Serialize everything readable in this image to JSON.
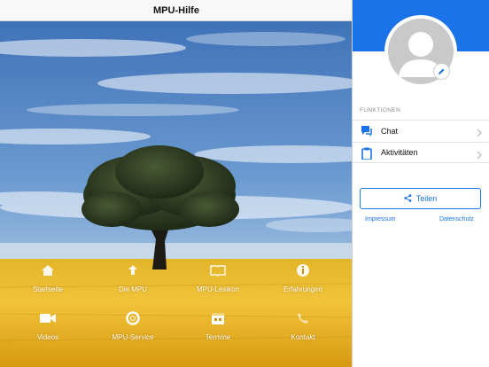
{
  "navbar": {
    "title": "MPU-Hilfe"
  },
  "grid": {
    "tiles": [
      {
        "label": "Startseite",
        "icon": "home-icon"
      },
      {
        "label": "Die MPU",
        "icon": "upload-icon"
      },
      {
        "label": "MPU-Lexikon",
        "icon": "book-icon"
      },
      {
        "label": "Erfahrungen",
        "icon": "info-icon"
      },
      {
        "label": "Videos",
        "icon": "video-icon"
      },
      {
        "label": "MPU-Service",
        "icon": "lifebuoy-icon"
      },
      {
        "label": "Termine",
        "icon": "calendar-icon"
      },
      {
        "label": "Kontakt",
        "icon": "phone-icon"
      }
    ]
  },
  "sidepanel": {
    "section_label": "FUNKTIONEN",
    "menu": [
      {
        "label": "Chat",
        "icon": "chat-icon"
      },
      {
        "label": "Aktivitäten",
        "icon": "clipboard-icon"
      }
    ],
    "share_label": "Teilen",
    "footer": {
      "impressum": "Impressum",
      "datenschutz": "Datenschutz"
    }
  },
  "colors": {
    "accent": "#1a73e8",
    "header_bg": "#f8f8f8",
    "avatar_gray": "#c9c9c9"
  }
}
